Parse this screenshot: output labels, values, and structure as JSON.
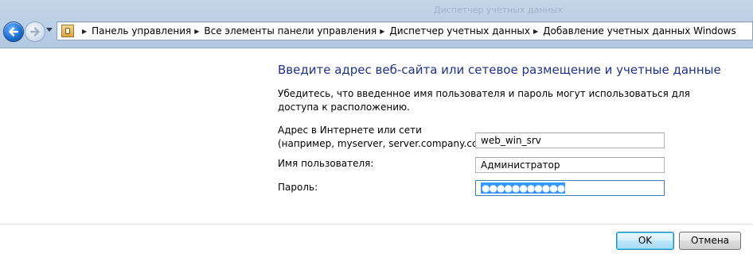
{
  "window": {
    "title": "Диспетчер учетных данных"
  },
  "navigation": {
    "back_icon": "back-arrow-icon",
    "forward_icon": "forward-arrow-icon",
    "recent_icon": "chevron-down-icon"
  },
  "breadcrumb": {
    "icon": "control-panel-icon",
    "items": [
      "Панель управления",
      "Все элементы панели управления",
      "Диспетчер учетных данных",
      "Добавление учетных данных Windows"
    ]
  },
  "main": {
    "heading": "Введите адрес веб-сайта или сетевое размещение и учетные данные",
    "description": "Убедитесь, что введенное имя пользователя и пароль могут использоваться для доступа к расположению.",
    "address_label_1": "Адрес в Интернете или сети",
    "address_label_2": "(например, myserver, server.company.com):",
    "address_value": "web_win_srv",
    "username_label": "Имя пользователя:",
    "username_value": "Администратор",
    "password_label": "Пароль:",
    "password_mask": "●●●●●●●●●●●"
  },
  "footer": {
    "ok_label": "OK",
    "cancel_label": "Отмена"
  },
  "colors": {
    "heading": "#1e3287",
    "chrome": "#bcd0e6",
    "selection": "#3399ff"
  }
}
